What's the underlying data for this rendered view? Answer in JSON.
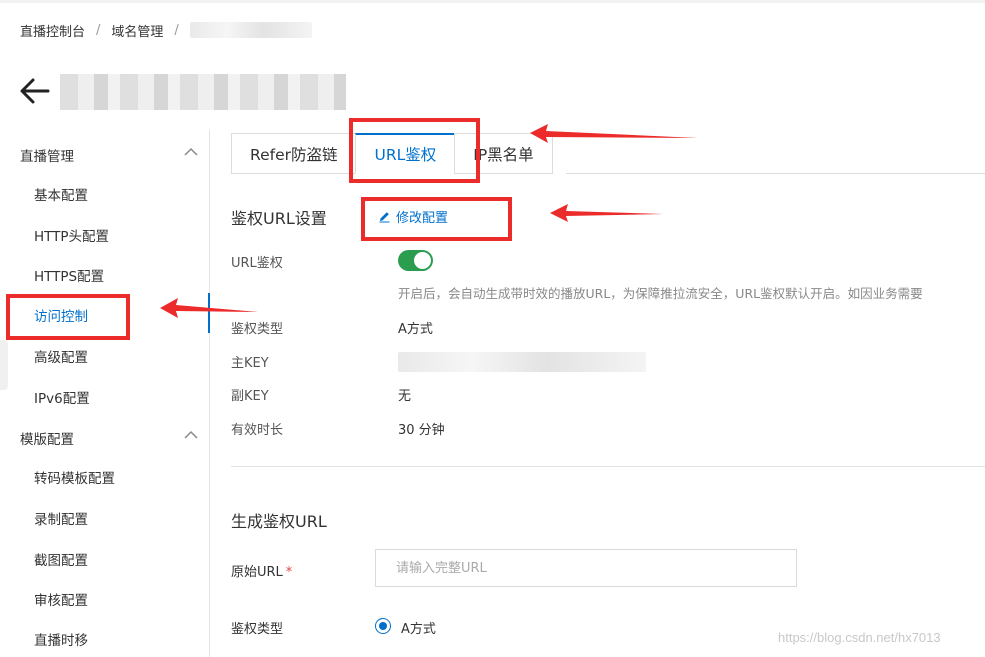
{
  "breadcrumb": {
    "items": [
      "直播控制台",
      "域名管理"
    ],
    "separator": "/"
  },
  "sidebar": {
    "groups": [
      {
        "label": "直播管理",
        "items": [
          "基本配置",
          "HTTP头配置",
          "HTTPS配置",
          "访问控制",
          "高级配置",
          "IPv6配置"
        ]
      },
      {
        "label": "模版配置",
        "items": [
          "转码模板配置",
          "录制配置",
          "截图配置",
          "审核配置",
          "直播时移"
        ]
      }
    ],
    "active_item": "访问控制"
  },
  "tabs": [
    "Refer防盗链",
    "URL鉴权",
    "IP黑名单"
  ],
  "active_tab": "URL鉴权",
  "auth_settings": {
    "title": "鉴权URL设置",
    "edit_label": "修改配置",
    "url_auth_label": "URL鉴权",
    "url_auth_enabled": true,
    "url_auth_desc": "开启后，会自动生成带时效的播放URL，为保障推拉流安全，URL鉴权默认开启。如因业务需要",
    "auth_type_label": "鉴权类型",
    "auth_type_value": "A方式",
    "primary_key_label": "主KEY",
    "secondary_key_label": "副KEY",
    "secondary_key_value": "无",
    "valid_duration_label": "有效时长",
    "valid_duration_value": "30 分钟"
  },
  "generate": {
    "title": "生成鉴权URL",
    "original_url_label": "原始URL",
    "required_mark": "*",
    "original_url_placeholder": "请输入完整URL",
    "auth_type_label": "鉴权类型",
    "auth_type_option": "A方式"
  },
  "watermark": "https://blog.csdn.net/hx7013",
  "colors": {
    "accent": "#0070cc",
    "toggle_on": "#2b9d4e",
    "annotation": "#ec2b2b"
  }
}
